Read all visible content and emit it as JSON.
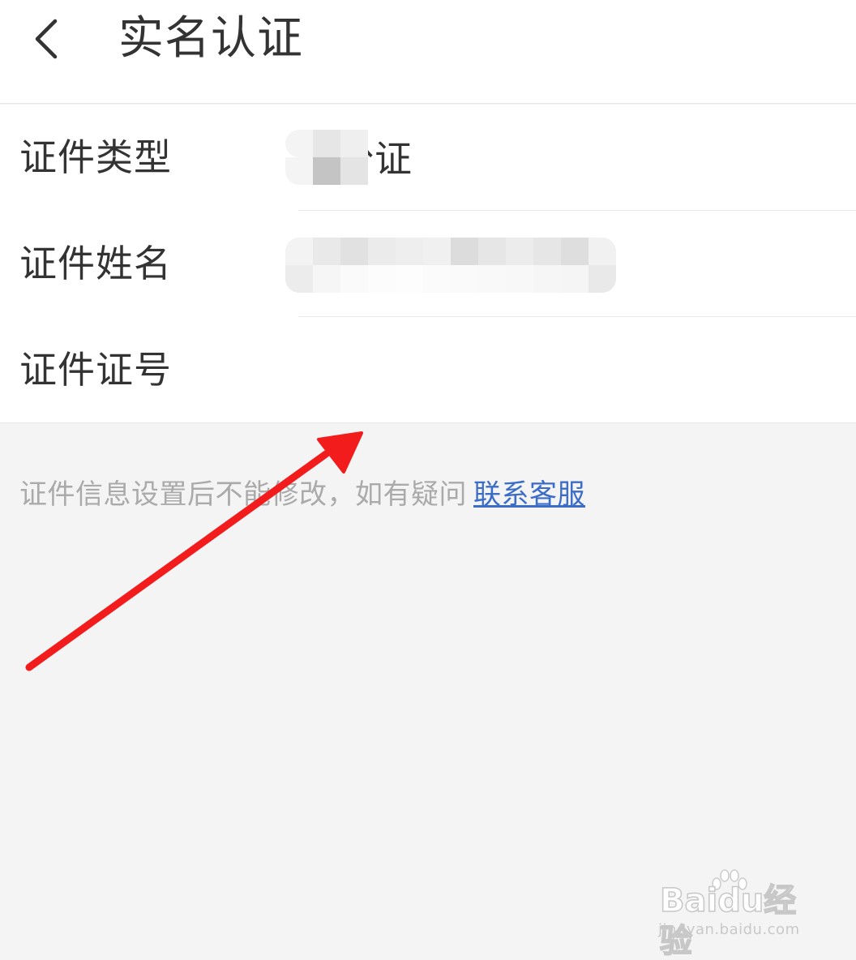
{
  "header": {
    "back_icon": "chevron-left-icon",
    "title": "实名认证"
  },
  "form": {
    "rows": [
      {
        "label": "证件类型",
        "value": "身份证"
      },
      {
        "label": "证件姓名",
        "value": ""
      },
      {
        "label": "证件证号",
        "value": ""
      }
    ]
  },
  "notice": {
    "text": "证件信息设置后不能修改，如有疑问",
    "link_label": "联系客服"
  },
  "watermark": {
    "logo_text": "Baidu经验",
    "url": "jingyan.baidu.com"
  },
  "colors": {
    "page_background": "#f4f4f4",
    "card_background": "#ffffff",
    "text_primary": "#333333",
    "text_hint": "#aaaaaa",
    "link": "#3a6cc8",
    "annotation_arrow": "#f21c1c"
  }
}
